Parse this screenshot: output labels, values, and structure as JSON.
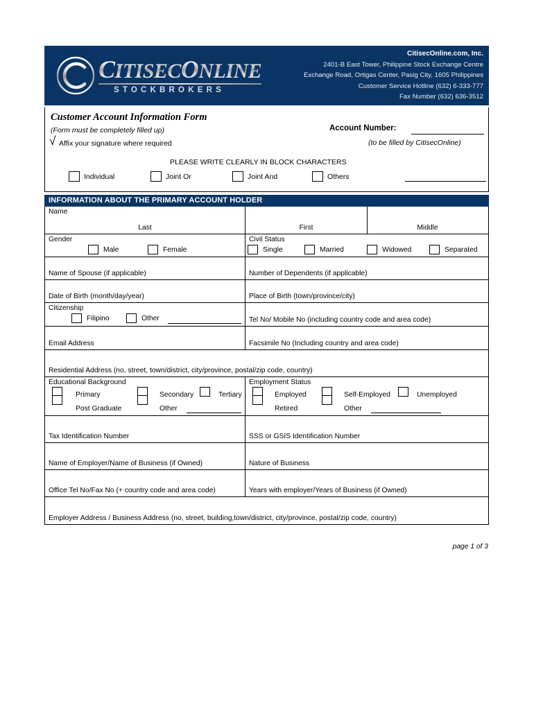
{
  "header": {
    "company": "CitisecOnline.com, Inc.",
    "address_line1": "2401-B East Tower, Philippine Stock Exchange Centre",
    "address_line2": "Exchange Road, Ortigas Center, Pasig City, 1605 Philippines",
    "hotline": "Customer Service Hotline (632) 6-333-777",
    "fax": "Fax Number (632) 636-3512",
    "logo_main": "ITISEC",
    "logo_main_cap1": "C",
    "logo_main_cap2": "O",
    "logo_main_tail": "NLINE",
    "logo_sub": "STOCKBROKERS",
    "brand_navy": "#0a3463"
  },
  "title_box": {
    "form_title": "Customer Account Information Form",
    "subtitle": "(Form must be completely filled up)",
    "account_number_label": "Account Number:",
    "check_glyph": "√",
    "affix_note": "Affix your signature where required",
    "to_be_filled": "(to be filled by CitisecOnline)",
    "block_chars_note": "PLEASE WRITE CLEARLY IN BLOCK CHARACTERS",
    "account_types": [
      {
        "label": "Individual"
      },
      {
        "label": "Joint Or"
      },
      {
        "label": "Joint And"
      },
      {
        "label": "Others"
      }
    ]
  },
  "section": {
    "title": "INFORMATION ABOUT THE PRIMARY ACCOUNT HOLDER"
  },
  "fields": {
    "name_label": "Name",
    "name_last": "Last",
    "name_first": "First",
    "name_middle": "Middle",
    "gender_label": "Gender",
    "gender_options": [
      {
        "label": "Male"
      },
      {
        "label": "Female"
      }
    ],
    "civil_status_label": "Civil Status",
    "civil_status_options": [
      {
        "label": "Single"
      },
      {
        "label": "Married"
      },
      {
        "label": "Widowed"
      },
      {
        "label": "Separated"
      }
    ],
    "spouse": "Name of Spouse (if applicable)",
    "dependents": "Number of Dependents (if applicable)",
    "date_of_birth": "Date of Birth (month/day/year)",
    "place_of_birth": "Place of Birth (town/province/city)",
    "citizenship_label": "Citizenship",
    "citizenship_options": [
      {
        "label": "Filipino"
      },
      {
        "label": "Other"
      }
    ],
    "tel_no": "Tel No/ Mobile No (including country code and area code)",
    "email": "Email Address",
    "facsimile": "Facsimile No (Including country and area code)",
    "residential_address": "Residential Address (no, street, town/district, city/province, postal/zip code, country)",
    "education_label": "Educational Background",
    "education_options": [
      {
        "label": "Primary"
      },
      {
        "label": "Secondary"
      },
      {
        "label": "Tertiary"
      },
      {
        "label": "Post Graduate"
      },
      {
        "label": "Other"
      }
    ],
    "employment_label": "Employment Status",
    "employment_options": [
      {
        "label": "Employed"
      },
      {
        "label": "Self-Employed"
      },
      {
        "label": "Unemployed"
      },
      {
        "label": "Retired"
      },
      {
        "label": "Other"
      }
    ],
    "tin": "Tax Identification Number",
    "sss_gsis": "SSS or GSIS Identification Number",
    "employer_name": "Name of Employer/Name of Business (if Owned)",
    "nature_of_business": "Nature of Business",
    "office_tel": "Office Tel No/Fax No (+ country code and area code)",
    "years_with_employer": "Years with employer/Years of Business (if Owned)",
    "employer_address": "Employer Address / Business Address (no, street, building,town/district, city/province, postal/zip code, country)"
  },
  "footer": {
    "page_indicator": "page 1 of 3"
  }
}
